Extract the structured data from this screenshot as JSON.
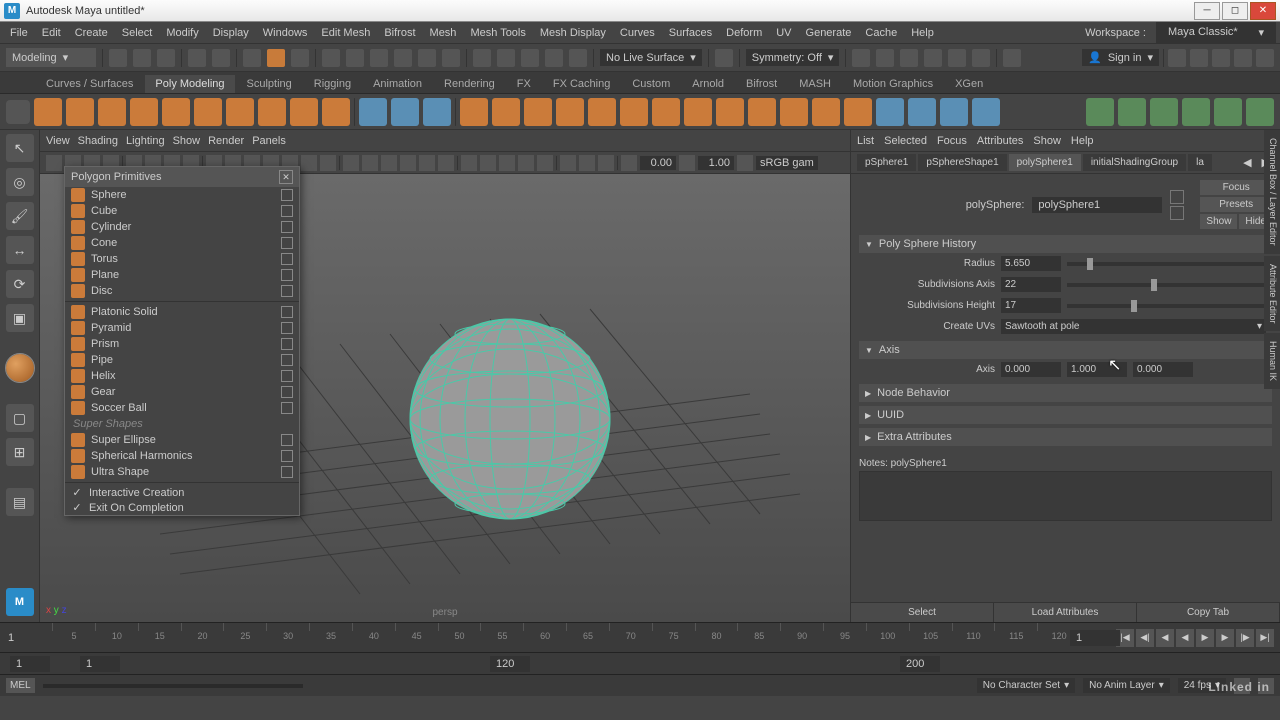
{
  "titlebar": {
    "title": "Autodesk Maya  untitled*"
  },
  "menubar": {
    "items": [
      "File",
      "Edit",
      "Create",
      "Select",
      "Modify",
      "Display",
      "Windows",
      "Edit Mesh",
      "Bifrost",
      "Mesh",
      "Mesh Tools",
      "Mesh Display",
      "Curves",
      "Surfaces",
      "Deform",
      "UV",
      "Generate",
      "Cache",
      "Help"
    ],
    "workspace_label": "Workspace :",
    "workspace_value": "Maya Classic*"
  },
  "statusline": {
    "mode": "Modeling",
    "live_surface": "No Live Surface",
    "symmetry": "Symmetry: Off",
    "signin": "Sign in"
  },
  "shelf": {
    "tabs": [
      "Curves / Surfaces",
      "Poly Modeling",
      "Sculpting",
      "Rigging",
      "Animation",
      "Rendering",
      "FX",
      "FX Caching",
      "Custom",
      "Arnold",
      "Bifrost",
      "MASH",
      "Motion Graphics",
      "XGen"
    ],
    "active_tab": 1
  },
  "vp": {
    "menu": [
      "View",
      "Shading",
      "Lighting",
      "Show",
      "Render",
      "Panels"
    ],
    "num1": "0.00",
    "num2": "1.00",
    "cs": "sRGB gam",
    "persp": "persp"
  },
  "popup": {
    "title": "Polygon Primitives",
    "items": [
      "Sphere",
      "Cube",
      "Cylinder",
      "Cone",
      "Torus",
      "Plane",
      "Disc"
    ],
    "items2": [
      "Platonic Solid",
      "Pyramid",
      "Prism",
      "Pipe",
      "Helix",
      "Gear",
      "Soccer Ball"
    ],
    "super_header": "Super Shapes",
    "items3": [
      "Super Ellipse",
      "Spherical Harmonics",
      "Ultra Shape"
    ],
    "checks": [
      "Interactive Creation",
      "Exit On Completion"
    ]
  },
  "attr": {
    "menu": [
      "List",
      "Selected",
      "Focus",
      "Attributes",
      "Show",
      "Help"
    ],
    "tabs": [
      "pSphere1",
      "pSphereShape1",
      "polySphere1",
      "initialShadingGroup",
      "la"
    ],
    "active_tab": 2,
    "focus": "Focus",
    "presets": "Presets",
    "show": "Show",
    "hide": "Hide",
    "node_label": "polySphere:",
    "node_value": "polySphere1",
    "groups": {
      "history": {
        "title": "Poly Sphere History",
        "radius_label": "Radius",
        "radius_value": "5.650",
        "subdiv_axis_label": "Subdivisions Axis",
        "subdiv_axis_value": "22",
        "subdiv_h_label": "Subdivisions Height",
        "subdiv_h_value": "17",
        "create_uv_label": "Create UVs",
        "create_uv_value": "Sawtooth at pole"
      },
      "axis": {
        "title": "Axis",
        "label": "Axis",
        "x": "0.000",
        "y": "1.000",
        "z": "0.000"
      },
      "node_behavior": "Node Behavior",
      "uuid": "UUID",
      "extra": "Extra Attributes"
    },
    "notes_label": "Notes:  polySphere1",
    "btm": [
      "Select",
      "Load Attributes",
      "Copy Tab"
    ]
  },
  "sidetabs": [
    "Channel Box / Layer Editor",
    "Attribute Editor",
    "Human IK"
  ],
  "timeline": {
    "marks": [
      "5",
      "10",
      "15",
      "20",
      "25",
      "30",
      "35",
      "40",
      "45",
      "50",
      "55",
      "60",
      "65",
      "70",
      "75",
      "80",
      "85",
      "90",
      "95",
      "100",
      "105",
      "110",
      "115",
      "120"
    ],
    "current": "1",
    "playhead": "1"
  },
  "range": {
    "start": "1",
    "playstart": "1",
    "playend": "120",
    "end": "200"
  },
  "bottom": {
    "char": "No Character Set",
    "anim": "No Anim Layer",
    "fps": "24 fps"
  },
  "watermark": "Linked in"
}
